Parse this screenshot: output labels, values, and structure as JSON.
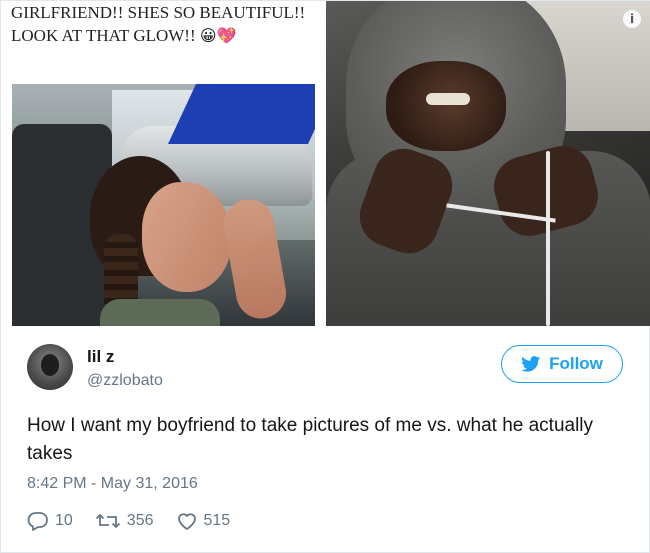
{
  "media": {
    "caption": "GIRLFRIEND!! SHES SO BEAUTIFUL!! LOOK AT THAT GLOW!!",
    "caption_emoji": "😀💖",
    "info_icon": "info-icon"
  },
  "author": {
    "display_name": "lil z",
    "handle": "@zzlobato"
  },
  "follow_button": {
    "label": "Follow",
    "icon": "twitter-bird-icon",
    "color": "#1da1f2"
  },
  "tweet": {
    "text": "How I want my boyfriend to take pictures of me vs. what he actually takes",
    "timestamp": "8:42 PM - May 31, 2016"
  },
  "actions": {
    "replies": "10",
    "retweets": "356",
    "likes": "515"
  },
  "colors": {
    "muted": "#657786",
    "text": "#14171a",
    "accent": "#1da1f2"
  }
}
